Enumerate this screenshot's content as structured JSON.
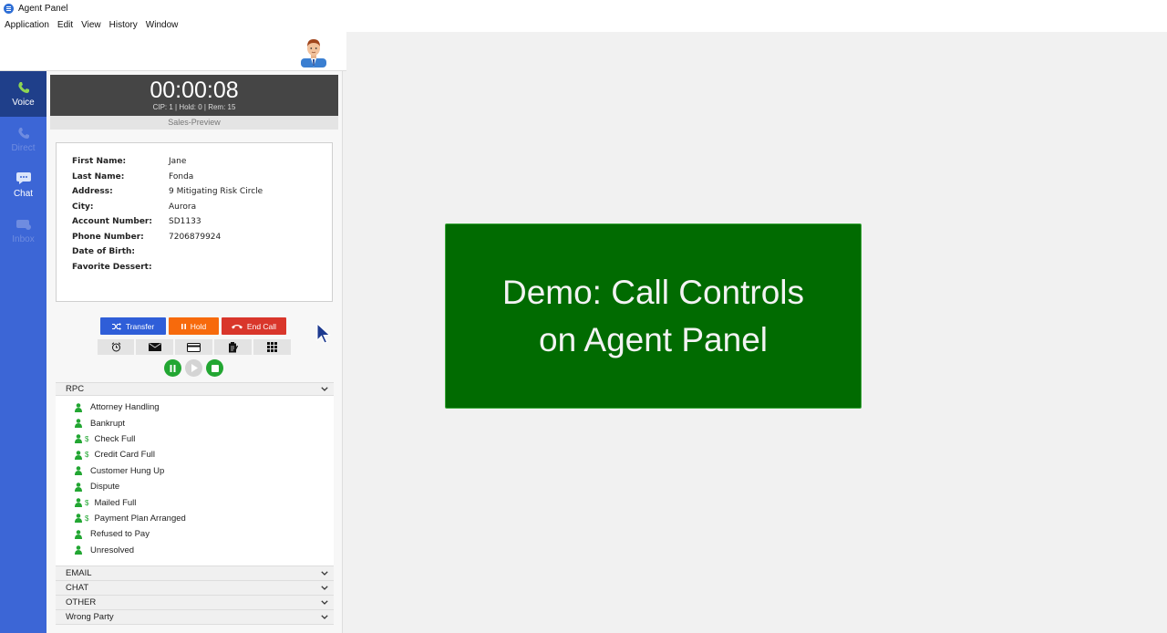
{
  "window": {
    "title": "Agent Panel"
  },
  "menu": [
    "Application",
    "Edit",
    "View",
    "History",
    "Window"
  ],
  "nav": {
    "voice": "Voice",
    "direct": "Direct",
    "chat": "Chat",
    "inbox": "Inbox"
  },
  "call": {
    "timer": "00:00:08",
    "stats": "CIP: 1 | Hold: 0 | Rem: 15",
    "campaign": "Sales-Preview"
  },
  "contact": [
    {
      "label": "First Name:",
      "value": "Jane"
    },
    {
      "label": "Last Name:",
      "value": "Fonda"
    },
    {
      "label": "Address:",
      "value": "9 Mitigating Risk Circle"
    },
    {
      "label": "City:",
      "value": "Aurora"
    },
    {
      "label": "Account Number:",
      "value": "SD1133"
    },
    {
      "label": "Phone Number:",
      "value": "7206879924"
    },
    {
      "label": "Date of Birth:",
      "value": ""
    },
    {
      "label": "Favorite Dessert:",
      "value": ""
    }
  ],
  "controls": {
    "transfer": "Transfer",
    "hold": "Hold",
    "end_call": "End Call"
  },
  "dispositions": {
    "rpc": {
      "label": "RPC",
      "items": [
        {
          "label": "Attorney Handling",
          "money": ""
        },
        {
          "label": "Bankrupt",
          "money": ""
        },
        {
          "label": "Check Full",
          "money": "$"
        },
        {
          "label": "Credit Card Full",
          "money": "$"
        },
        {
          "label": "Customer Hung Up",
          "money": ""
        },
        {
          "label": "Dispute",
          "money": ""
        },
        {
          "label": "Mailed Full",
          "money": "$"
        },
        {
          "label": "Payment Plan Arranged",
          "money": "$"
        },
        {
          "label": "Refused to Pay",
          "money": ""
        },
        {
          "label": "Unresolved",
          "money": ""
        }
      ]
    },
    "email": "EMAIL",
    "chat": "CHAT",
    "other": "OTHER",
    "wrong_party": "Wrong Party"
  },
  "overlay": {
    "line1": "Demo: Call Controls",
    "line2": "on Agent Panel"
  },
  "colors": {
    "nav_blue": "#3c66d6",
    "nav_active": "#1f3f8a",
    "transfer": "#2f5ed8",
    "hold": "#f76a0c",
    "end_call": "#d9362b",
    "overlay_green": "#016b01",
    "record_green": "#22a632"
  }
}
